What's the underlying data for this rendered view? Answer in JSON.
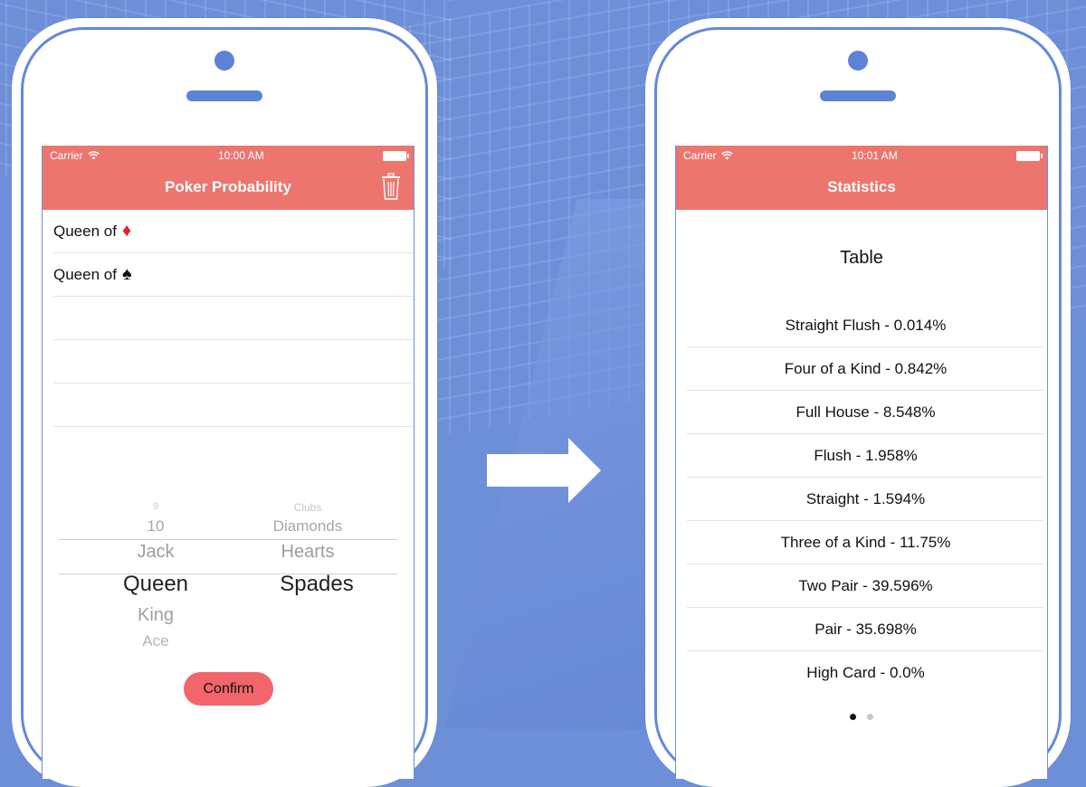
{
  "colors": {
    "background": "#6d8fd8",
    "navbar": "#ec766d",
    "confirm": "#f2656b",
    "phone_border": "#6489d8"
  },
  "left_screen": {
    "status": {
      "carrier": "Carrier",
      "time": "10:00 AM"
    },
    "title": "Poker Probability",
    "icon": "trash-icon",
    "cards": [
      {
        "label": "Queen of",
        "suit": "♦",
        "suit_name": "diamond"
      },
      {
        "label": "Queen of",
        "suit": "♠",
        "suit_name": "spade"
      }
    ],
    "picker": {
      "ranks": [
        "9",
        "10",
        "Jack",
        "Queen",
        "King",
        "Ace"
      ],
      "selected_rank": "Queen",
      "suits": [
        "Clubs",
        "Diamonds",
        "Hearts",
        "Spades"
      ],
      "selected_suit": "Spades"
    },
    "confirm_label": "Confirm"
  },
  "right_screen": {
    "status": {
      "carrier": "Carrier",
      "time": "10:01 AM"
    },
    "title": "Statistics",
    "heading": "Table",
    "stats": [
      "Straight Flush - 0.014%",
      "Four of a Kind - 0.842%",
      "Full House - 8.548%",
      "Flush - 1.958%",
      "Straight - 1.594%",
      "Three of a Kind - 11.75%",
      "Two Pair - 39.596%",
      "Pair - 35.698%",
      "High Card - 0.0%"
    ],
    "page": {
      "current": 1,
      "total": 2
    }
  }
}
